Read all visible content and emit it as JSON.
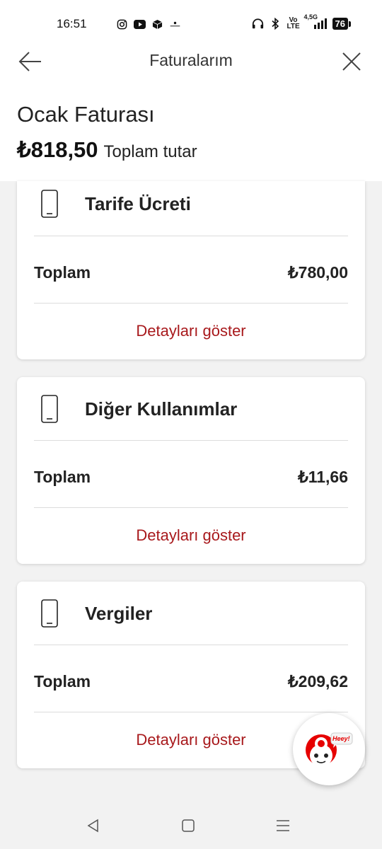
{
  "status_bar": {
    "time": "16:51",
    "network": "4,5G",
    "volte": "Vo LTE",
    "battery": "76"
  },
  "nav": {
    "title": "Faturalarım",
    "back_icon": "arrow-left-icon",
    "close_icon": "close-icon"
  },
  "bill": {
    "title": "Ocak Faturası",
    "amount": "₺818,50",
    "amount_label": "Toplam tutar"
  },
  "cards": [
    {
      "title": "Tarife Ücreti",
      "row_label": "Toplam",
      "row_value": "₺780,00",
      "link": "Detayları göster"
    },
    {
      "title": "Diğer Kullanımlar",
      "row_label": "Toplam",
      "row_value": "₺11,66",
      "link": "Detayları göster"
    },
    {
      "title": "Vergiler",
      "row_label": "Toplam",
      "row_value": "₺209,62",
      "link": "Detayları göster"
    }
  ],
  "chat": {
    "bubble_text": "Heey!"
  },
  "colors": {
    "accent": "#a8191c",
    "brand_red": "#e60000"
  }
}
